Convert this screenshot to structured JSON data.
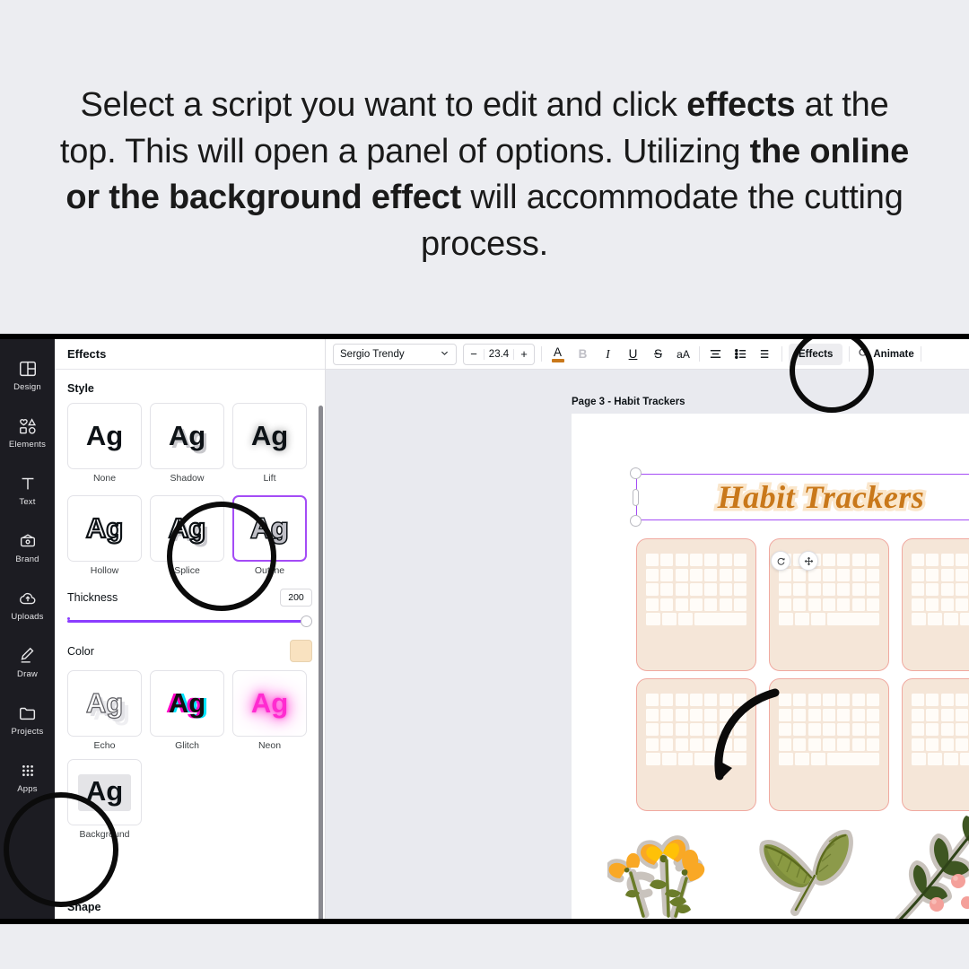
{
  "heading": {
    "part1": "Select a script you want to edit and click ",
    "bold1": "effects",
    "part2": " at the top. This will open a panel of options. Utilizing ",
    "bold2": "the online or the background effect",
    "part3": " will accommodate the cutting process."
  },
  "sidebar": {
    "items": [
      {
        "label": "Design",
        "icon": "design-icon"
      },
      {
        "label": "Elements",
        "icon": "elements-icon"
      },
      {
        "label": "Text",
        "icon": "text-icon"
      },
      {
        "label": "Brand",
        "icon": "brand-icon"
      },
      {
        "label": "Uploads",
        "icon": "uploads-icon"
      },
      {
        "label": "Draw",
        "icon": "draw-icon"
      },
      {
        "label": "Projects",
        "icon": "projects-icon"
      },
      {
        "label": "Apps",
        "icon": "apps-icon"
      }
    ]
  },
  "panel": {
    "title": "Effects",
    "style_section": "Style",
    "shape_section": "Shape",
    "sample_text": "Ag",
    "styles_row1": [
      {
        "label": "None",
        "selected": false
      },
      {
        "label": "Shadow",
        "selected": false
      },
      {
        "label": "Lift",
        "selected": false
      }
    ],
    "styles_row2": [
      {
        "label": "Hollow",
        "selected": false
      },
      {
        "label": "Splice",
        "selected": false
      },
      {
        "label": "Outline",
        "selected": true
      }
    ],
    "styles_row3": [
      {
        "label": "Echo",
        "selected": false
      },
      {
        "label": "Glitch",
        "selected": false
      },
      {
        "label": "Neon",
        "selected": false
      }
    ],
    "styles_row4": [
      {
        "label": "Background",
        "selected": false
      }
    ],
    "thickness": {
      "label": "Thickness",
      "value": "200",
      "percent": 100
    },
    "color": {
      "label": "Color",
      "value": "#F9E2C0"
    }
  },
  "toolbar": {
    "font_name": "Sergio Trendy",
    "decrease": "−",
    "font_size": "23.4",
    "increase": "+",
    "text_color": "A",
    "bold": "B",
    "italic": "I",
    "underline": "U",
    "strikethrough": "S",
    "case": "aA",
    "effects_label": "Effects",
    "animate_label": "Animate",
    "accent_color": "#C9781A"
  },
  "canvas": {
    "page_label": "Page 3 - Habit Trackers",
    "title_text": "Habit Trackers",
    "title_fill": "#C9781A",
    "title_outline": "#FAE6CB",
    "selection_color": "#A44CF6",
    "tracker_bg": "#F5E6D8",
    "tracker_border": "#F0A9A0",
    "float_buttons": [
      {
        "name": "rotate-handle",
        "glyph": "↻"
      },
      {
        "name": "move-handle",
        "glyph": "✥"
      }
    ]
  }
}
